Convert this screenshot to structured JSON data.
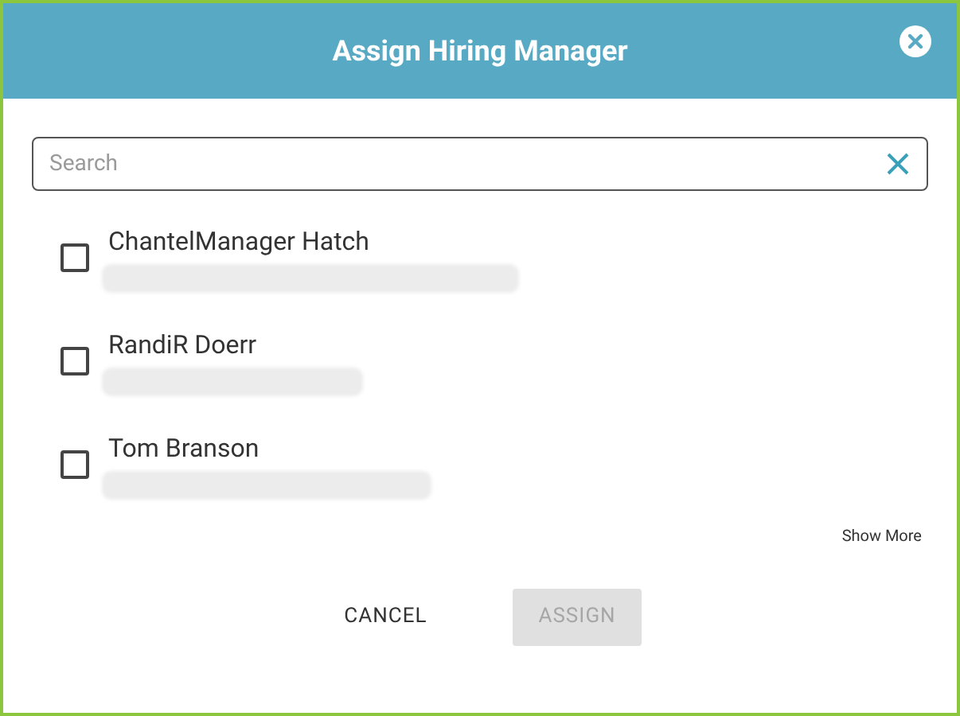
{
  "dialog": {
    "title": "Assign Hiring Manager"
  },
  "search": {
    "placeholder": "Search"
  },
  "people": [
    {
      "name": "ChantelManager Hatch",
      "checked": false
    },
    {
      "name": "RandiR Doerr",
      "checked": false
    },
    {
      "name": "Tom Branson",
      "checked": false
    }
  ],
  "show_more": "Show More",
  "buttons": [
    {
      "label": "CANCEL",
      "disabled": false
    },
    {
      "label": "ASSIGN",
      "disabled": true
    }
  ]
}
